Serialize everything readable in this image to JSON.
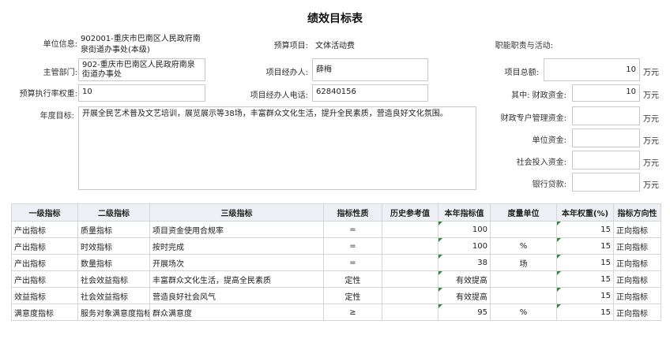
{
  "title": "绩效目标表",
  "form": {
    "unit_label": "单位信息:",
    "unit_value": "902001-重庆市巴南区人民政府南泉街道办事处(本级)",
    "budget_item_label": "预算项目:",
    "budget_item_value": "文体活动费",
    "duty_label": "职能职责与活动:",
    "dept_label": "主管部门:",
    "dept_value": "902-重庆市巴南区人民政府南泉街道办事处",
    "manager_label": "项目经办人:",
    "manager_value": "薛梅",
    "total_label": "项目总额:",
    "total_value": "10",
    "exec_rate_label": "预算执行率权重:",
    "exec_rate_value": "10",
    "phone_label": "项目经办人电话:",
    "phone_value": "62840156",
    "fiscal_label": "其中:  财政资金:",
    "fiscal_value": "10",
    "annual_goal_label": "年度目标:",
    "annual_goal_value": "开展全民艺术普及文艺培训，展览展示等38场，丰富群众文化生活，提升全民素质，营造良好文化氛围。",
    "fiscal_special_label": "财政专户管理资金:",
    "fiscal_special_value": "",
    "unit_fund_label": "单位资金:",
    "unit_fund_value": "",
    "social_label": "社会投入资金:",
    "social_value": "",
    "loan_label": "银行贷款:",
    "loan_value": "",
    "currency": "万元"
  },
  "table": {
    "headers": [
      "一级指标",
      "二级指标",
      "三级指标",
      "指标性质",
      "历史参考值",
      "本年指标值",
      "度量单位",
      "本年权重(%)",
      "指标方向性"
    ],
    "rows": [
      [
        "产出指标",
        "质量指标",
        "项目资金使用合规率",
        "=",
        "",
        "100",
        "",
        "15",
        "正向指标"
      ],
      [
        "产出指标",
        "时效指标",
        "按时完成",
        "=",
        "",
        "100",
        "%",
        "15",
        "正向指标"
      ],
      [
        "产出指标",
        "数量指标",
        "开展场次",
        "=",
        "",
        "38",
        "场",
        "15",
        "正向指标"
      ],
      [
        "产出指标",
        "社会效益指标",
        "丰富群众文化生活，提高全民素质",
        "定性",
        "",
        "有效提高",
        "",
        "15",
        "正向指标"
      ],
      [
        "效益指标",
        "社会效益指标",
        "营造良好社会风气",
        "定性",
        "",
        "有效提高",
        "",
        "15",
        "正向指标"
      ],
      [
        "满意度指标",
        "服务对象满意度指标",
        "群众满意度",
        "≥",
        "",
        "95",
        "%",
        "15",
        "正向指标"
      ]
    ]
  }
}
